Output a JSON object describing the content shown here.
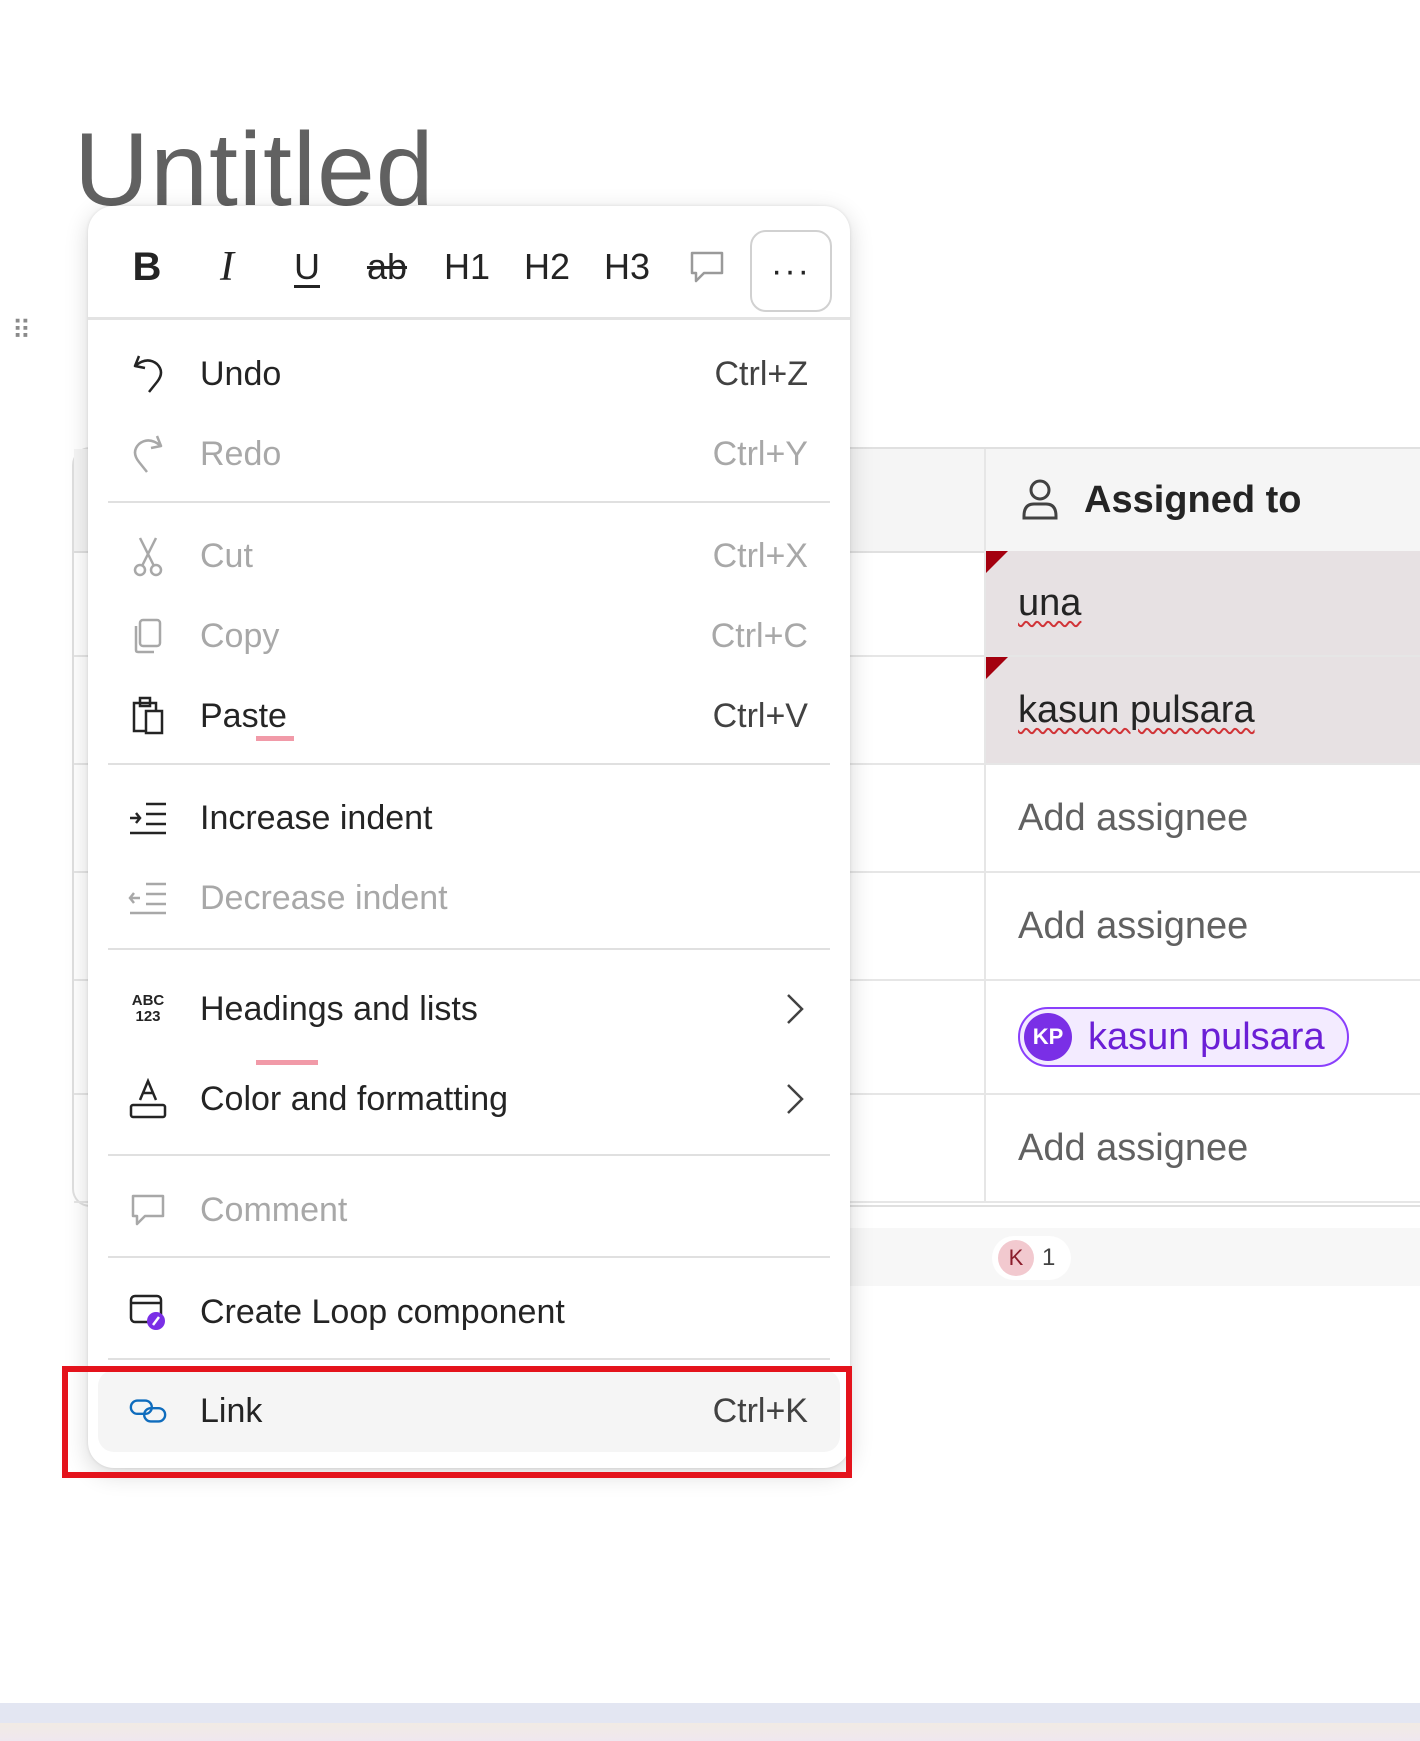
{
  "page": {
    "title": "Untitled"
  },
  "table": {
    "assigned_header": "Assigned to",
    "rows": [
      {
        "assignee": "una",
        "type": "error"
      },
      {
        "assignee": "kasun pulsara",
        "type": "error"
      },
      {
        "assignee": "Add assignee",
        "type": "placeholder"
      },
      {
        "assignee": "Add assignee",
        "type": "placeholder"
      },
      {
        "assignee": "kasun pulsara",
        "type": "chip",
        "initials": "KP"
      },
      {
        "assignee": "Add assignee",
        "type": "placeholder"
      }
    ],
    "presence": {
      "initial": "K",
      "count": "1"
    }
  },
  "toolbar": {
    "bold": "B",
    "italic": "I",
    "underline": "U",
    "strikethrough": "ab",
    "h1": "H1",
    "h2": "H2",
    "h3": "H3",
    "more": "···"
  },
  "menu": {
    "undo": {
      "label": "Undo",
      "shortcut": "Ctrl+Z"
    },
    "redo": {
      "label": "Redo",
      "shortcut": "Ctrl+Y"
    },
    "cut": {
      "label": "Cut",
      "shortcut": "Ctrl+X"
    },
    "copy": {
      "label": "Copy",
      "shortcut": "Ctrl+C"
    },
    "paste": {
      "label": "Paste",
      "shortcut": "Ctrl+V"
    },
    "increase_indent": {
      "label": "Increase indent"
    },
    "decrease_indent": {
      "label": "Decrease indent"
    },
    "headings_lists": {
      "label": "Headings and lists",
      "icon_text_top": "ABC",
      "icon_text_bottom": "123"
    },
    "color_formatting": {
      "label": "Color and formatting"
    },
    "comment": {
      "label": "Comment"
    },
    "create_loop": {
      "label": "Create Loop component"
    },
    "link": {
      "label": "Link",
      "shortcut": "Ctrl+K"
    }
  },
  "colors": {
    "highlight_border": "#e4131c",
    "chip_accent": "#8a3ffc",
    "error_marker": "#a4000f",
    "link_icon": "#0f6cbd"
  }
}
